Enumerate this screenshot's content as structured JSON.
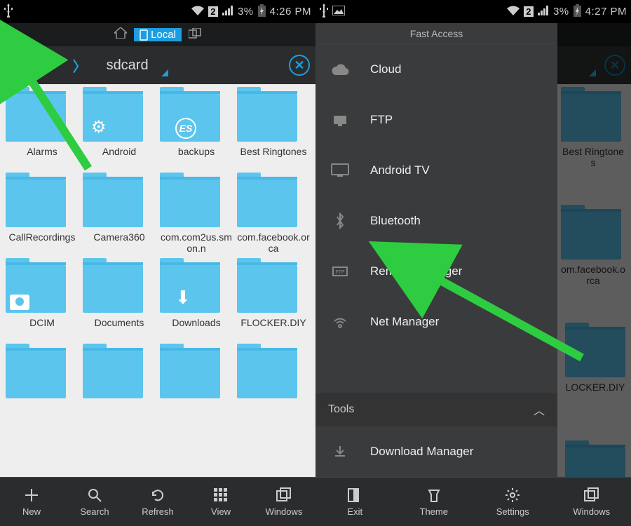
{
  "left": {
    "status": {
      "battery": "3%",
      "time": "4:26 PM",
      "sim": "2"
    },
    "location_tag": "Local",
    "path": {
      "root": "/",
      "current": "sdcard"
    },
    "folders": [
      {
        "name": "Alarms"
      },
      {
        "name": "Android",
        "overlay": "gear"
      },
      {
        "name": "backups",
        "overlay": "es"
      },
      {
        "name": "Best Ringtones"
      },
      {
        "name": "CallRecordings"
      },
      {
        "name": "Camera360"
      },
      {
        "name": "com.com2us.smon.n"
      },
      {
        "name": "com.facebook.orca"
      },
      {
        "name": "DCIM",
        "overlay": "camera"
      },
      {
        "name": "Documents"
      },
      {
        "name": "Downloads",
        "overlay": "download"
      },
      {
        "name": "FLOCKER.DIY"
      },
      {
        "name": ""
      },
      {
        "name": ""
      },
      {
        "name": ""
      },
      {
        "name": ""
      }
    ],
    "bottom": [
      {
        "label": "New",
        "icon": "plus"
      },
      {
        "label": "Search",
        "icon": "search"
      },
      {
        "label": "Refresh",
        "icon": "refresh"
      },
      {
        "label": "View",
        "icon": "grid"
      },
      {
        "label": "Windows",
        "icon": "windows"
      }
    ]
  },
  "right": {
    "status": {
      "battery": "3%",
      "time": "4:27 PM",
      "sim": "2"
    },
    "drawer_header": "Fast Access",
    "drawer_items": [
      {
        "label": "Cloud",
        "icon": "cloud"
      },
      {
        "label": "FTP",
        "icon": "ftp"
      },
      {
        "label": "Android TV",
        "icon": "tv"
      },
      {
        "label": "Bluetooth",
        "icon": "bt"
      },
      {
        "label": "Remote Manager",
        "icon": "remote"
      },
      {
        "label": "Net Manager",
        "icon": "wifi"
      }
    ],
    "drawer_section": "Tools",
    "drawer_items2": [
      {
        "label": "Download Manager",
        "icon": "download"
      }
    ],
    "bottom": [
      {
        "label": "Exit",
        "icon": "exit"
      },
      {
        "label": "Theme",
        "icon": "theme"
      },
      {
        "label": "Settings",
        "icon": "gear"
      },
      {
        "label": "Windows",
        "icon": "windows"
      }
    ],
    "bg_folders": [
      {
        "name": "Best Ringtones"
      },
      {
        "name": "om.facebook.orca"
      },
      {
        "name": "LOCKER.DIY"
      },
      {
        "name": ""
      }
    ]
  }
}
